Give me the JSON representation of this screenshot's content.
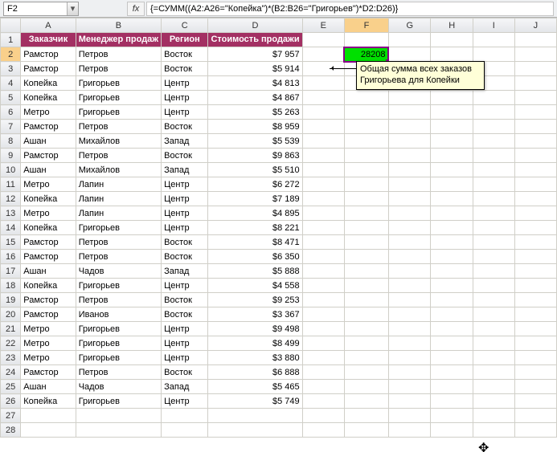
{
  "formula_bar": {
    "cell_ref": "F2",
    "fx_label": "fx",
    "formula": "{=СУММ((A2:A26=\"Копейка\")*(B2:B26=\"Григорьев\")*D2:D26)}"
  },
  "columns": [
    "A",
    "B",
    "C",
    "D",
    "E",
    "F",
    "G",
    "H",
    "I",
    "J"
  ],
  "headers": {
    "A": "Заказчик",
    "B": "Менеджер продаж",
    "C": "Регион",
    "D": "Стоимость продажи"
  },
  "rows": [
    {
      "r": 2,
      "a": "Рамстор",
      "b": "Петров",
      "c": "Восток",
      "d": "$7 957"
    },
    {
      "r": 3,
      "a": "Рамстор",
      "b": "Петров",
      "c": "Восток",
      "d": "$5 914"
    },
    {
      "r": 4,
      "a": "Копейка",
      "b": "Григорьев",
      "c": "Центр",
      "d": "$4 813"
    },
    {
      "r": 5,
      "a": "Копейка",
      "b": "Григорьев",
      "c": "Центр",
      "d": "$4 867"
    },
    {
      "r": 6,
      "a": "Метро",
      "b": "Григорьев",
      "c": "Центр",
      "d": "$5 263"
    },
    {
      "r": 7,
      "a": "Рамстор",
      "b": "Петров",
      "c": "Восток",
      "d": "$8 959"
    },
    {
      "r": 8,
      "a": "Ашан",
      "b": "Михайлов",
      "c": "Запад",
      "d": "$5 539"
    },
    {
      "r": 9,
      "a": "Рамстор",
      "b": "Петров",
      "c": "Восток",
      "d": "$9 863"
    },
    {
      "r": 10,
      "a": "Ашан",
      "b": "Михайлов",
      "c": "Запад",
      "d": "$5 510"
    },
    {
      "r": 11,
      "a": "Метро",
      "b": "Лапин",
      "c": "Центр",
      "d": "$6 272"
    },
    {
      "r": 12,
      "a": "Копейка",
      "b": "Лапин",
      "c": "Центр",
      "d": "$7 189"
    },
    {
      "r": 13,
      "a": "Метро",
      "b": "Лапин",
      "c": "Центр",
      "d": "$4 895"
    },
    {
      "r": 14,
      "a": "Копейка",
      "b": "Григорьев",
      "c": "Центр",
      "d": "$8 221"
    },
    {
      "r": 15,
      "a": "Рамстор",
      "b": "Петров",
      "c": "Восток",
      "d": "$8 471"
    },
    {
      "r": 16,
      "a": "Рамстор",
      "b": "Петров",
      "c": "Восток",
      "d": "$6 350"
    },
    {
      "r": 17,
      "a": "Ашан",
      "b": "Чадов",
      "c": "Запад",
      "d": "$5 888"
    },
    {
      "r": 18,
      "a": "Копейка",
      "b": "Григорьев",
      "c": "Центр",
      "d": "$4 558"
    },
    {
      "r": 19,
      "a": "Рамстор",
      "b": "Петров",
      "c": "Восток",
      "d": "$9 253"
    },
    {
      "r": 20,
      "a": "Рамстор",
      "b": "Иванов",
      "c": "Восток",
      "d": "$3 367"
    },
    {
      "r": 21,
      "a": "Метро",
      "b": "Григорьев",
      "c": "Центр",
      "d": "$9 498"
    },
    {
      "r": 22,
      "a": "Метро",
      "b": "Григорьев",
      "c": "Центр",
      "d": "$8 499"
    },
    {
      "r": 23,
      "a": "Метро",
      "b": "Григорьев",
      "c": "Центр",
      "d": "$3 880"
    },
    {
      "r": 24,
      "a": "Рамстор",
      "b": "Петров",
      "c": "Восток",
      "d": "$6 888"
    },
    {
      "r": 25,
      "a": "Ашан",
      "b": "Чадов",
      "c": "Запад",
      "d": "$5 465"
    },
    {
      "r": 26,
      "a": "Копейка",
      "b": "Григорьев",
      "c": "Центр",
      "d": "$5 749"
    }
  ],
  "empty_rows": [
    27,
    28
  ],
  "result_cell": {
    "value": "28208"
  },
  "comment": "Общая сумма всех заказов Григорьева для Копейки",
  "colors": {
    "header_bg": "#a33063",
    "result_bg": "#00e000",
    "result_border": "#880088"
  }
}
